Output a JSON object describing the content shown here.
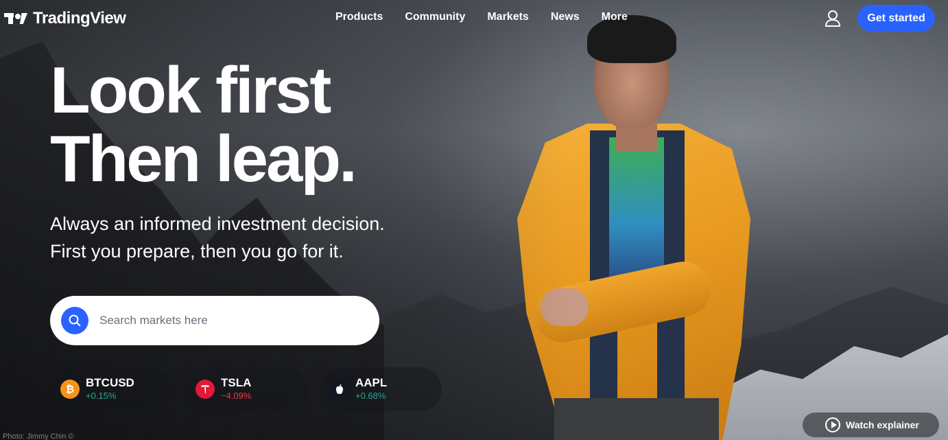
{
  "brand": {
    "name": "TradingView"
  },
  "nav": {
    "links": [
      "Products",
      "Community",
      "Markets",
      "News",
      "More"
    ],
    "cta_label": "Get started"
  },
  "hero": {
    "headline_line1": "Look first",
    "headline_line2": "Then leap.",
    "sub_line1": "Always an informed investment decision.",
    "sub_line2": "First you prepare, then you go for it."
  },
  "search": {
    "placeholder": "Search markets here"
  },
  "tickers": [
    {
      "symbol": "BTCUSD",
      "change": "+0.15%",
      "direction": "up",
      "icon": "bitcoin-icon",
      "icon_color": "#f7931a"
    },
    {
      "symbol": "TSLA",
      "change": "−4.09%",
      "direction": "down",
      "icon": "tesla-icon",
      "icon_color": "#e31937"
    },
    {
      "symbol": "AAPL",
      "change": "+0.68%",
      "direction": "up",
      "icon": "apple-icon",
      "icon_color": "#131722"
    }
  ],
  "footer": {
    "photo_credit": "Photo: Jimmy Chin ©",
    "watch_label": "Watch explainer"
  },
  "colors": {
    "accent": "#2962ff",
    "up": "#22ab94",
    "down": "#f23645"
  }
}
